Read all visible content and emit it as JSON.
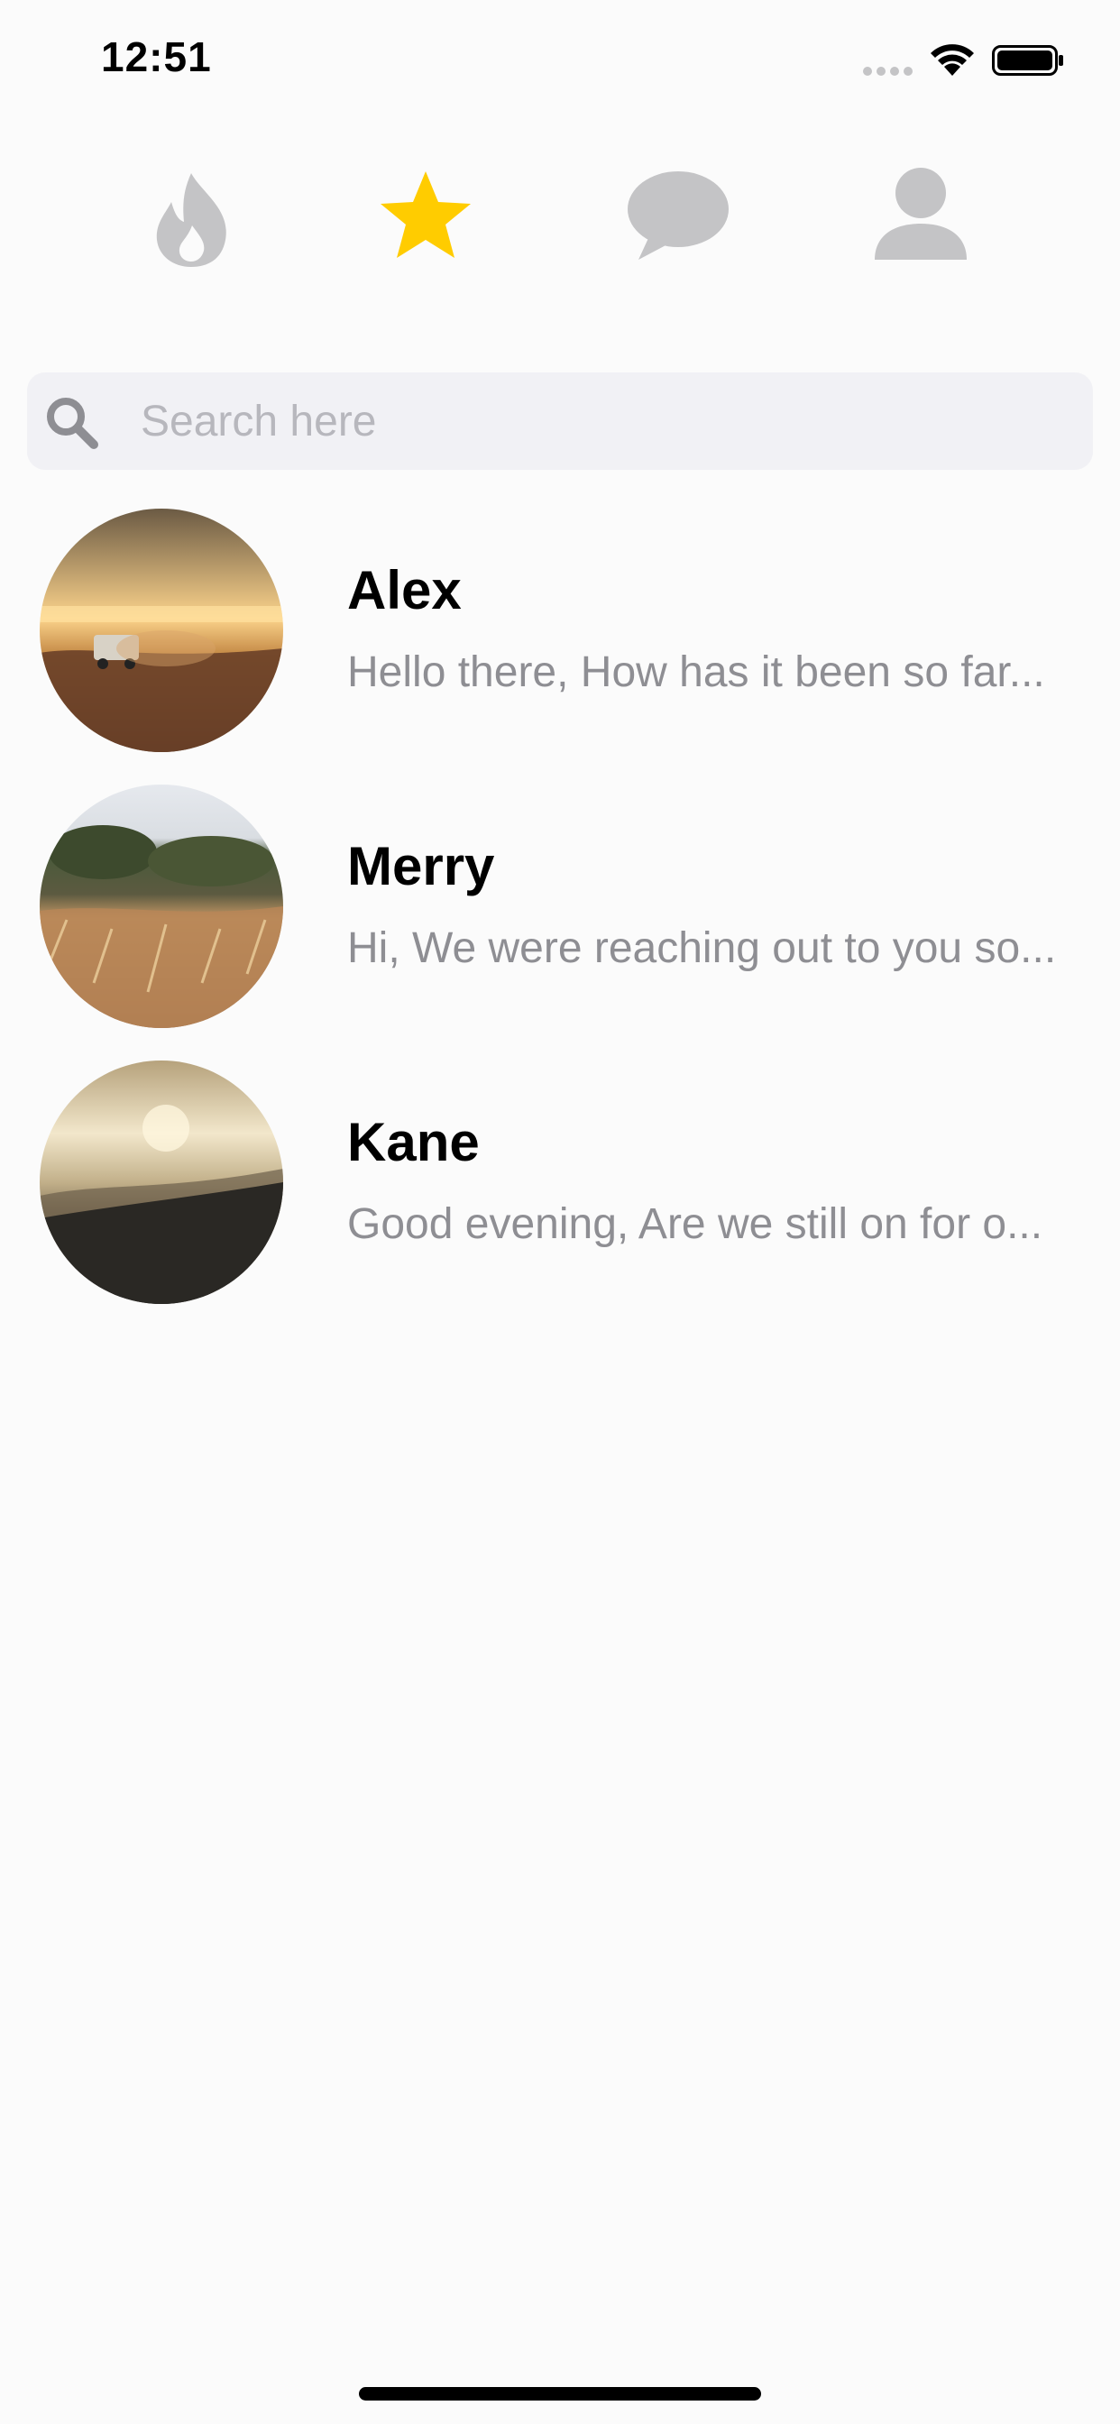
{
  "status_bar": {
    "time": "12:51",
    "icons": [
      "signal-dots-icon",
      "wifi-icon",
      "battery-icon"
    ]
  },
  "nav": {
    "items": [
      {
        "name": "discover",
        "icon": "flame-icon",
        "active": false
      },
      {
        "name": "favorites",
        "icon": "star-icon",
        "active": true
      },
      {
        "name": "messages",
        "icon": "chat-bubble-icon",
        "active": false
      },
      {
        "name": "profile",
        "icon": "person-icon",
        "active": false
      }
    ],
    "colors": {
      "active": "#ffcc00",
      "inactive": "#c4c4c6"
    }
  },
  "search": {
    "placeholder": "Search here",
    "value": ""
  },
  "chats": [
    {
      "name": "Alex",
      "preview": "Hello there, How has it been so far..."
    },
    {
      "name": "Merry",
      "preview": "Hi, We were reaching out to you so..."
    },
    {
      "name": "Kane",
      "preview": "Good evening, Are we still on for o..."
    }
  ]
}
